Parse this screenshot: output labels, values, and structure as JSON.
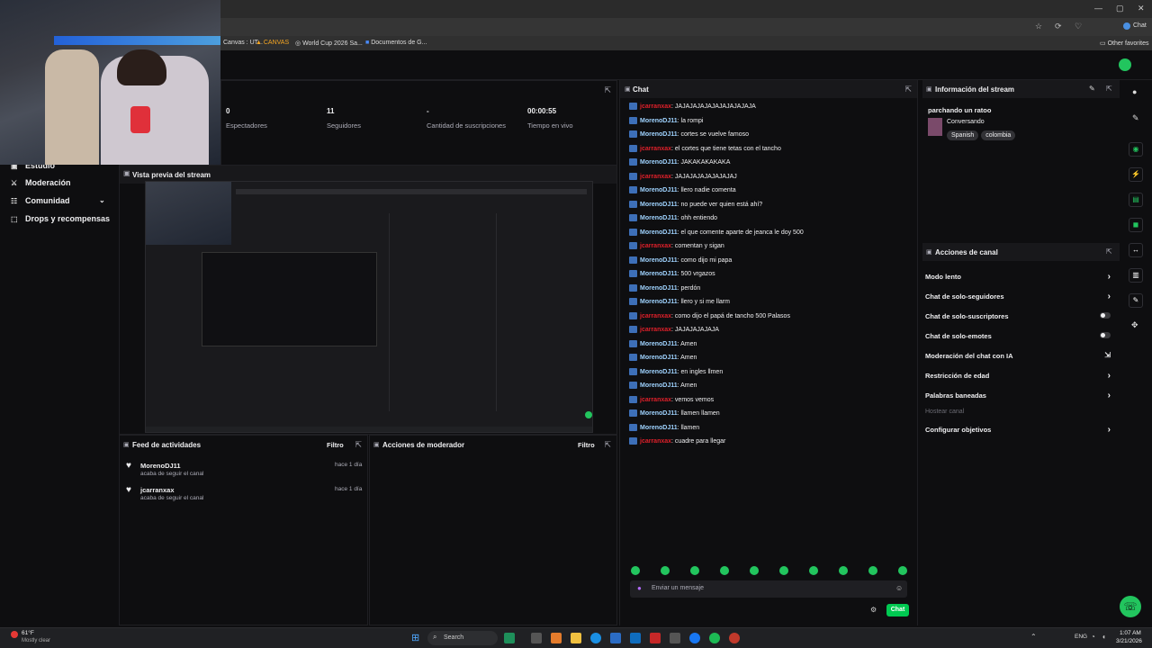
{
  "browser": {
    "bookmarks": [
      "Canvas : UT...",
      "CANVAS",
      "World Cup 2026 Sa...",
      "Documentos de G..."
    ],
    "other_favorites": "Other favorites",
    "profile": "Chat"
  },
  "nav": {
    "items": [
      {
        "label": "Estudio",
        "icon": "studio-icon"
      },
      {
        "label": "Moderación",
        "icon": "sword-icon"
      },
      {
        "label": "Comunidad",
        "icon": "community-icon"
      },
      {
        "label": "Drops y recompensas",
        "icon": "gift-icon"
      }
    ]
  },
  "stats": [
    {
      "value": "0",
      "label": "Espectadores"
    },
    {
      "value": "11",
      "label": "Seguidores"
    },
    {
      "value": "-",
      "label": "Cantidad de suscripciones"
    },
    {
      "value": "00:00:55",
      "label": "Tiempo en vivo"
    }
  ],
  "preview": {
    "title": "Vista previa del stream"
  },
  "activity": {
    "title": "Feed de actividades",
    "filter": "Filtro",
    "items": [
      {
        "user": "MorenoDJ11",
        "text": "acaba de seguir el canal",
        "time": "hace 1 día"
      },
      {
        "user": "jcarranxax",
        "text": "acaba de seguir el canal",
        "time": "hace 1 día"
      }
    ]
  },
  "mod_actions": {
    "title": "Acciones de moderador",
    "filter": "Filtro"
  },
  "chat": {
    "title": "Chat",
    "messages": [
      {
        "user": "jcarranxax",
        "text": ": JAJAJAJAJAJAJAJAJAJAJA"
      },
      {
        "user": "MorenoDJ11",
        "text": ": la rompi"
      },
      {
        "user": "MorenoDJ11",
        "text": ": cortes se vuelve famoso"
      },
      {
        "user": "jcarranxax",
        "text": ": el cortes que tiene tetas con el tancho"
      },
      {
        "user": "MorenoDJ11",
        "text": ": JAKAKAKAKAKA"
      },
      {
        "user": "jcarranxax",
        "text": ": JAJAJAJAJAJAJAJAJ"
      },
      {
        "user": "MorenoDJ11",
        "text": ": llero nadie comenta"
      },
      {
        "user": "MorenoDJ11",
        "text": ": no puede ver quien está ahí?"
      },
      {
        "user": "MorenoDJ11",
        "text": ": ohh entiendo"
      },
      {
        "user": "MorenoDJ11",
        "text": ": el que comente aparte de jeanca le doy 500"
      },
      {
        "user": "jcarranxax",
        "text": ": comentan y sigan"
      },
      {
        "user": "MorenoDJ11",
        "text": ": como dijo mi papa"
      },
      {
        "user": "MorenoDJ11",
        "text": ": 500 vrgazos"
      },
      {
        "user": "MorenoDJ11",
        "text": ": perdón"
      },
      {
        "user": "MorenoDJ11",
        "text": ": llero y si me llarm"
      },
      {
        "user": "jcarranxax",
        "text": ": como dijo el papá de tancho 500 Palasos"
      },
      {
        "user": "jcarranxax",
        "text": ": JAJAJAJAJAJA"
      },
      {
        "user": "MorenoDJ11",
        "text": ": Amen"
      },
      {
        "user": "MorenoDJ11",
        "text": ": Amen"
      },
      {
        "user": "MorenoDJ11",
        "text": ": en ingles llmen"
      },
      {
        "user": "MorenoDJ11",
        "text": ": Amen"
      },
      {
        "user": "jcarranxax",
        "text": ": vemos vemos"
      },
      {
        "user": "MorenoDJ11",
        "text": ": llamen llamen"
      },
      {
        "user": "MorenoDJ11",
        "text": ": llamen"
      },
      {
        "user": "jcarranxax",
        "text": ": cuadre para llegar"
      }
    ],
    "input_placeholder": "Enviar un mensaje",
    "send_label": "Chat"
  },
  "stream_info": {
    "title": "Información del stream",
    "stream_title": "parchando un ratoo",
    "category": "Conversando",
    "tags": [
      "Spanish",
      "colombia"
    ]
  },
  "channel_actions": {
    "title": "Acciones de canal",
    "items": [
      {
        "label": "Modo lento",
        "control": "chevron"
      },
      {
        "label": "Chat de solo-seguidores",
        "control": "chevron"
      },
      {
        "label": "Chat de solo-suscriptores",
        "control": "toggle"
      },
      {
        "label": "Chat de solo-emotes",
        "control": "toggle"
      },
      {
        "label": "Moderación del chat con IA",
        "control": "external"
      },
      {
        "label": "Restricción de edad",
        "control": "chevron"
      },
      {
        "label": "Palabras baneadas",
        "control": "chevron"
      },
      {
        "label": "Hostear canal",
        "control": "none"
      },
      {
        "label": "Configurar objetivos",
        "control": "chevron"
      }
    ]
  },
  "taskbar": {
    "weather_temp": "61°F",
    "weather_text": "Mostly clear",
    "search": "Search",
    "lang": "ENG",
    "time": "1:07 AM",
    "date": "3/21/2026"
  },
  "colors": {
    "accent": "#00c951",
    "mod_name": "#9fd3ff",
    "red_name": "#e0202a"
  }
}
